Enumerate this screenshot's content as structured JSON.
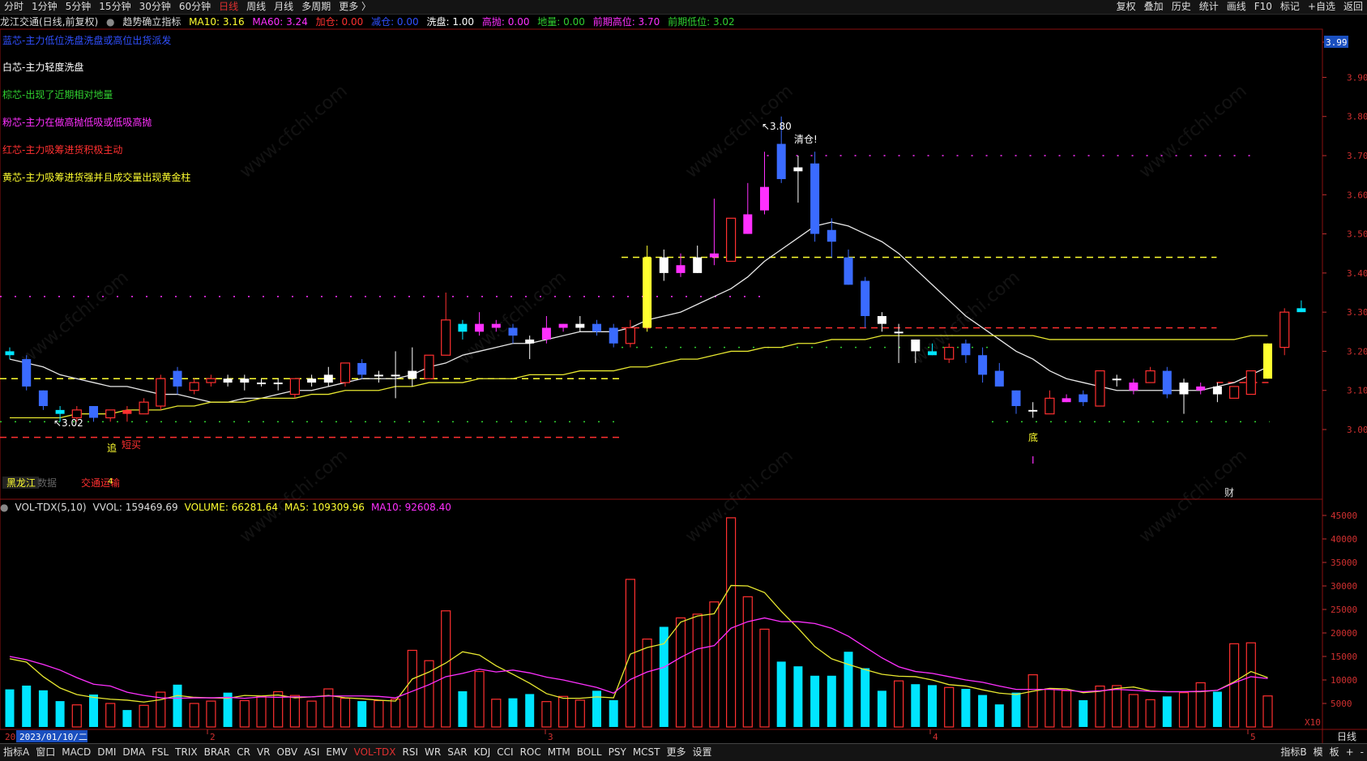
{
  "toolbar": {
    "periods": [
      "分时",
      "1分钟",
      "5分钟",
      "15分钟",
      "30分钟",
      "60分钟",
      "日线",
      "周线",
      "月线",
      "多周期",
      "更多 〉"
    ],
    "active_period": "日线",
    "right_items": [
      "复权",
      "叠加",
      "历史",
      "统计",
      "画线",
      "F10",
      "标记",
      "+自选",
      "返回"
    ]
  },
  "info": {
    "stock": "龙江交通(日线,前复权)",
    "indicator": "趋势确立指标",
    "ma10": "MA10: 3.16",
    "ma60": "MA60: 3.24",
    "jiacang": "加仓: 0.00",
    "jiancang": "减仓: 0.00",
    "xipan": "洗盘: 1.00",
    "gaopao": "高抛: 0.00",
    "diliang": "地量: 0.00",
    "qianqi_high": "前期高位: 3.70",
    "qianqi_low": "前期低位: 3.02"
  },
  "legend": [
    {
      "text": "蓝芯-主力低位洗盘洗盘或高位出货派发",
      "color": "#3050ff"
    },
    {
      "text": "白芯-主力轻度洗盘",
      "color": "#ffffff"
    },
    {
      "text": "棕芯-出现了近期相对地量",
      "color": "#30d030"
    },
    {
      "text": "粉芯-主力在做高抛低吸或低吸高抛",
      "color": "#ff30ff"
    },
    {
      "text": "红芯-主力吸筹进货积极主动",
      "color": "#ff3030"
    },
    {
      "text": "黄芯-主力吸筹进货强并且成交量出现黄金柱",
      "color": "#ffff30"
    }
  ],
  "annotations": {
    "high_label": "3.80",
    "low_label": "3.02",
    "qingcang": "清仓!",
    "zhui": "追",
    "duanmai": "短买",
    "di": "底",
    "i_mark": "I",
    "cai": "财",
    "heilongjiang": "黑龙江",
    "shuju": "数据",
    "jiaotong": "交通运输",
    "count": "4"
  },
  "price_axis": [
    "3.99",
    "3.90",
    "3.80",
    "3.70",
    "3.60",
    "3.50",
    "3.40",
    "3.30",
    "3.20",
    "3.10",
    "3.00"
  ],
  "volume_info": {
    "name": "VOL-TDX(5,10)",
    "vvol": "VVOL: 159469.69",
    "volume": "VOLUME: 66281.64",
    "ma5": "MA5: 109309.96",
    "ma10": "MA10: 92608.40"
  },
  "volume_axis": [
    "45000",
    "40000",
    "35000",
    "30000",
    "25000",
    "20000",
    "15000",
    "10000",
    "5000"
  ],
  "vol_unit": "X10",
  "date_axis": {
    "date_label": "2023/01/10/二",
    "months": [
      "2",
      "3",
      "4",
      "5"
    ],
    "start": "20"
  },
  "bottom_tabs": [
    "指标A",
    "窗口",
    "MACD",
    "DMI",
    "DMA",
    "FSL",
    "TRIX",
    "BRAR",
    "CR",
    "VR",
    "OBV",
    "ASI",
    "EMV",
    "VOL-TDX",
    "RSI",
    "WR",
    "SAR",
    "KDJ",
    "CCI",
    "ROC",
    "MTM",
    "BOLL",
    "PSY",
    "MCST",
    "更多",
    "设置"
  ],
  "active_tab": "VOL-TDX",
  "bottom_right": [
    "指标B",
    "模",
    "板",
    "+",
    "-"
  ],
  "period_label": "日线",
  "chart_data": {
    "type": "candlestick",
    "y_range": [
      2.98,
      4.0
    ],
    "vol_range": [
      0,
      45000
    ],
    "candles": [
      {
        "o": 3.2,
        "h": 3.21,
        "l": 3.18,
        "c": 3.19,
        "col": "cyan"
      },
      {
        "o": 3.18,
        "h": 3.19,
        "l": 3.1,
        "c": 3.11,
        "col": "blue"
      },
      {
        "o": 3.1,
        "h": 3.1,
        "l": 3.05,
        "c": 3.06,
        "col": "blue"
      },
      {
        "o": 3.05,
        "h": 3.06,
        "l": 3.02,
        "c": 3.04,
        "col": "cyan"
      },
      {
        "o": 3.03,
        "h": 3.06,
        "l": 3.02,
        "c": 3.05,
        "col": "red"
      },
      {
        "o": 3.06,
        "h": 3.06,
        "l": 3.02,
        "c": 3.03,
        "col": "blue"
      },
      {
        "o": 3.03,
        "h": 3.05,
        "l": 3.02,
        "c": 3.05,
        "col": "red"
      },
      {
        "o": 3.05,
        "h": 3.06,
        "l": 3.02,
        "c": 3.04,
        "col": "red"
      },
      {
        "o": 3.04,
        "h": 3.08,
        "l": 3.04,
        "c": 3.07,
        "col": "red"
      },
      {
        "o": 3.06,
        "h": 3.14,
        "l": 3.05,
        "c": 3.13,
        "col": "red"
      },
      {
        "o": 3.15,
        "h": 3.16,
        "l": 3.09,
        "c": 3.11,
        "col": "blue"
      },
      {
        "o": 3.1,
        "h": 3.13,
        "l": 3.09,
        "c": 3.12,
        "col": "red"
      },
      {
        "o": 3.12,
        "h": 3.14,
        "l": 3.11,
        "c": 3.13,
        "col": "red"
      },
      {
        "o": 3.13,
        "h": 3.14,
        "l": 3.11,
        "c": 3.12,
        "col": "white"
      },
      {
        "o": 3.12,
        "h": 3.14,
        "l": 3.1,
        "c": 3.13,
        "col": "white"
      },
      {
        "o": 3.12,
        "h": 3.13,
        "l": 3.11,
        "c": 3.12,
        "col": "white"
      },
      {
        "o": 3.12,
        "h": 3.13,
        "l": 3.1,
        "c": 3.12,
        "col": "white"
      },
      {
        "o": 3.09,
        "h": 3.13,
        "l": 3.08,
        "c": 3.13,
        "col": "red"
      },
      {
        "o": 3.12,
        "h": 3.14,
        "l": 3.11,
        "c": 3.13,
        "col": "white"
      },
      {
        "o": 3.12,
        "h": 3.16,
        "l": 3.11,
        "c": 3.14,
        "col": "white"
      },
      {
        "o": 3.12,
        "h": 3.17,
        "l": 3.11,
        "c": 3.17,
        "col": "red"
      },
      {
        "o": 3.17,
        "h": 3.18,
        "l": 3.13,
        "c": 3.14,
        "col": "blue"
      },
      {
        "o": 3.14,
        "h": 3.15,
        "l": 3.12,
        "c": 3.14,
        "col": "white"
      },
      {
        "o": 3.14,
        "h": 3.2,
        "l": 3.08,
        "c": 3.14,
        "col": "white"
      },
      {
        "o": 3.13,
        "h": 3.21,
        "l": 3.11,
        "c": 3.15,
        "col": "white"
      },
      {
        "o": 3.13,
        "h": 3.19,
        "l": 3.13,
        "c": 3.19,
        "col": "red"
      },
      {
        "o": 3.19,
        "h": 3.35,
        "l": 3.19,
        "c": 3.28,
        "col": "red"
      },
      {
        "o": 3.27,
        "h": 3.28,
        "l": 3.23,
        "c": 3.25,
        "col": "cyan"
      },
      {
        "o": 3.25,
        "h": 3.3,
        "l": 3.24,
        "c": 3.27,
        "col": "pink"
      },
      {
        "o": 3.26,
        "h": 3.28,
        "l": 3.25,
        "c": 3.27,
        "col": "pink"
      },
      {
        "o": 3.26,
        "h": 3.27,
        "l": 3.22,
        "c": 3.24,
        "col": "blue"
      },
      {
        "o": 3.23,
        "h": 3.24,
        "l": 3.18,
        "c": 3.22,
        "col": "white"
      },
      {
        "o": 3.23,
        "h": 3.29,
        "l": 3.22,
        "c": 3.26,
        "col": "pink"
      },
      {
        "o": 3.26,
        "h": 3.27,
        "l": 3.25,
        "c": 3.27,
        "col": "pink"
      },
      {
        "o": 3.26,
        "h": 3.29,
        "l": 3.25,
        "c": 3.27,
        "col": "white"
      },
      {
        "o": 3.27,
        "h": 3.28,
        "l": 3.24,
        "c": 3.25,
        "col": "blue"
      },
      {
        "o": 3.26,
        "h": 3.27,
        "l": 3.21,
        "c": 3.22,
        "col": "blue"
      },
      {
        "o": 3.22,
        "h": 3.28,
        "l": 3.21,
        "c": 3.26,
        "col": "red"
      },
      {
        "o": 3.26,
        "h": 3.47,
        "l": 3.25,
        "c": 3.44,
        "col": "yellow"
      },
      {
        "o": 3.44,
        "h": 3.46,
        "l": 3.38,
        "c": 3.4,
        "col": "white"
      },
      {
        "o": 3.4,
        "h": 3.45,
        "l": 3.39,
        "c": 3.42,
        "col": "pink"
      },
      {
        "o": 3.4,
        "h": 3.47,
        "l": 3.4,
        "c": 3.44,
        "col": "white"
      },
      {
        "o": 3.44,
        "h": 3.59,
        "l": 3.42,
        "c": 3.45,
        "col": "pink"
      },
      {
        "o": 3.43,
        "h": 3.54,
        "l": 3.43,
        "c": 3.54,
        "col": "red"
      },
      {
        "o": 3.5,
        "h": 3.63,
        "l": 3.5,
        "c": 3.55,
        "col": "pink"
      },
      {
        "o": 3.56,
        "h": 3.71,
        "l": 3.55,
        "c": 3.62,
        "col": "pink"
      },
      {
        "o": 3.73,
        "h": 3.8,
        "l": 3.63,
        "c": 3.64,
        "col": "blue"
      },
      {
        "o": 3.67,
        "h": 3.7,
        "l": 3.58,
        "c": 3.66,
        "col": "white"
      },
      {
        "o": 3.68,
        "h": 3.71,
        "l": 3.48,
        "c": 3.5,
        "col": "blue"
      },
      {
        "o": 3.51,
        "h": 3.54,
        "l": 3.44,
        "c": 3.48,
        "col": "blue"
      },
      {
        "o": 3.44,
        "h": 3.46,
        "l": 3.37,
        "c": 3.37,
        "col": "blue"
      },
      {
        "o": 3.38,
        "h": 3.39,
        "l": 3.26,
        "c": 3.29,
        "col": "blue"
      },
      {
        "o": 3.29,
        "h": 3.3,
        "l": 3.25,
        "c": 3.27,
        "col": "white"
      },
      {
        "o": 3.25,
        "h": 3.27,
        "l": 3.17,
        "c": 3.25,
        "col": "white"
      },
      {
        "o": 3.23,
        "h": 3.23,
        "l": 3.17,
        "c": 3.2,
        "col": "white"
      },
      {
        "o": 3.2,
        "h": 3.22,
        "l": 3.19,
        "c": 3.19,
        "col": "cyan"
      },
      {
        "o": 3.18,
        "h": 3.22,
        "l": 3.17,
        "c": 3.21,
        "col": "red"
      },
      {
        "o": 3.22,
        "h": 3.23,
        "l": 3.17,
        "c": 3.19,
        "col": "blue"
      },
      {
        "o": 3.19,
        "h": 3.21,
        "l": 3.12,
        "c": 3.14,
        "col": "blue"
      },
      {
        "o": 3.15,
        "h": 3.17,
        "l": 3.11,
        "c": 3.11,
        "col": "blue"
      },
      {
        "o": 3.1,
        "h": 3.1,
        "l": 3.04,
        "c": 3.06,
        "col": "blue"
      },
      {
        "o": 3.05,
        "h": 3.07,
        "l": 3.03,
        "c": 3.05,
        "col": "white"
      },
      {
        "o": 3.04,
        "h": 3.1,
        "l": 3.04,
        "c": 3.08,
        "col": "red"
      },
      {
        "o": 3.07,
        "h": 3.09,
        "l": 3.07,
        "c": 3.08,
        "col": "pink"
      },
      {
        "o": 3.09,
        "h": 3.1,
        "l": 3.06,
        "c": 3.07,
        "col": "blue"
      },
      {
        "o": 3.06,
        "h": 3.15,
        "l": 3.06,
        "c": 3.15,
        "col": "red"
      },
      {
        "o": 3.13,
        "h": 3.14,
        "l": 3.11,
        "c": 3.13,
        "col": "white"
      },
      {
        "o": 3.1,
        "h": 3.13,
        "l": 3.09,
        "c": 3.12,
        "col": "pink"
      },
      {
        "o": 3.12,
        "h": 3.16,
        "l": 3.12,
        "c": 3.15,
        "col": "red"
      },
      {
        "o": 3.15,
        "h": 3.16,
        "l": 3.08,
        "c": 3.09,
        "col": "blue"
      },
      {
        "o": 3.09,
        "h": 3.13,
        "l": 3.04,
        "c": 3.12,
        "col": "white"
      },
      {
        "o": 3.1,
        "h": 3.12,
        "l": 3.09,
        "c": 3.11,
        "col": "pink"
      },
      {
        "o": 3.11,
        "h": 3.12,
        "l": 3.07,
        "c": 3.09,
        "col": "white"
      },
      {
        "o": 3.08,
        "h": 3.11,
        "l": 3.08,
        "c": 3.11,
        "col": "red"
      },
      {
        "o": 3.09,
        "h": 3.15,
        "l": 3.09,
        "c": 3.15,
        "col": "red"
      },
      {
        "o": 3.13,
        "h": 3.22,
        "l": 3.13,
        "c": 3.22,
        "col": "yellow"
      },
      {
        "o": 3.21,
        "h": 3.31,
        "l": 3.19,
        "c": 3.3,
        "col": "red"
      },
      {
        "o": 3.3,
        "h": 3.33,
        "l": 3.3,
        "c": 3.31,
        "col": "cyan"
      }
    ],
    "volumes": [
      8000,
      8800,
      7800,
      5500,
      4700,
      6900,
      5000,
      3600,
      4600,
      7400,
      9000,
      5000,
      5500,
      7300,
      5600,
      6500,
      7500,
      6700,
      5500,
      8100,
      6100,
      5500,
      5600,
      5900,
      16300,
      14100,
      24700,
      7600,
      11800,
      5900,
      6100,
      7000,
      5400,
      6500,
      5700,
      7700,
      5700,
      31400,
      18700,
      21300,
      23200,
      24000,
      26600,
      44500,
      27700,
      20800,
      13900,
      12900,
      10900,
      10900,
      16000,
      12500,
      7700,
      9800,
      9100,
      8900,
      8400,
      8100,
      6800,
      4800,
      7300,
      11100,
      8100,
      7700,
      5700,
      8700,
      8800,
      6900,
      5800,
      6500,
      7300,
      9400,
      7500,
      17700,
      17900,
      6600
    ],
    "ma_vol_short": [
      14500,
      13800,
      10700,
      8300,
      6900,
      6300,
      5900,
      5700,
      5300,
      5800,
      6700,
      6300,
      6200,
      6100,
      6700,
      6600,
      6800,
      6200,
      6400,
      6700,
      6200,
      6000,
      5700,
      5500,
      10200,
      11700,
      13600,
      16000,
      15300,
      13000,
      11200,
      9300,
      7100,
      6100,
      6100,
      6400,
      6200,
      15500,
      16900,
      17700,
      22300,
      23600,
      24100,
      30100,
      30000,
      28600,
      24600,
      21000,
      17100,
      14500,
      13300,
      12200,
      11200,
      10800,
      10700,
      10000,
      9000,
      8700,
      7900,
      7200,
      6900,
      7600,
      8200,
      8100,
      7300,
      7600,
      8200,
      8500,
      7700,
      7500,
      7500,
      7500,
      7800,
      9600,
      11800,
      10500
    ],
    "ma_vol_long": [
      15000,
      14300,
      13300,
      12100,
      10500,
      9100,
      8700,
      7400,
      6700,
      6200,
      6100,
      6200,
      6200,
      6300,
      6100,
      6400,
      6300,
      6400,
      6400,
      6600,
      6600,
      6600,
      6500,
      6200,
      7600,
      9000,
      10700,
      11400,
      12300,
      11700,
      12100,
      11500,
      10600,
      10000,
      9200,
      8400,
      7200,
      10100,
      11700,
      12700,
      14800,
      16600,
      17300,
      21000,
      22400,
      23200,
      22400,
      22400,
      22000,
      21000,
      19300,
      17000,
      14700,
      12800,
      11800,
      11400,
      10700,
      10000,
      9500,
      8700,
      8000,
      8000,
      8000,
      7800,
      7500,
      7700,
      8000,
      7800,
      7600,
      7500,
      7500,
      7600,
      7800,
      9400,
      10700,
      10300
    ],
    "ma_price_short": [
      3.18,
      3.17,
      3.16,
      3.14,
      3.13,
      3.12,
      3.11,
      3.11,
      3.1,
      3.09,
      3.09,
      3.08,
      3.07,
      3.07,
      3.08,
      3.08,
      3.09,
      3.1,
      3.1,
      3.11,
      3.12,
      3.13,
      3.13,
      3.13,
      3.14,
      3.16,
      3.17,
      3.19,
      3.2,
      3.21,
      3.22,
      3.22,
      3.23,
      3.24,
      3.25,
      3.25,
      3.25,
      3.26,
      3.28,
      3.29,
      3.3,
      3.32,
      3.34,
      3.36,
      3.39,
      3.43,
      3.46,
      3.49,
      3.52,
      3.53,
      3.52,
      3.5,
      3.48,
      3.45,
      3.41,
      3.37,
      3.33,
      3.29,
      3.26,
      3.23,
      3.2,
      3.18,
      3.15,
      3.13,
      3.12,
      3.11,
      3.1,
      3.1,
      3.1,
      3.1,
      3.1,
      3.1,
      3.11,
      3.12,
      3.14,
      3.16
    ],
    "ma_price_long": [
      3.03,
      3.03,
      3.03,
      3.03,
      3.04,
      3.04,
      3.04,
      3.05,
      3.05,
      3.05,
      3.06,
      3.06,
      3.07,
      3.07,
      3.07,
      3.08,
      3.08,
      3.08,
      3.09,
      3.09,
      3.1,
      3.1,
      3.1,
      3.11,
      3.11,
      3.12,
      3.12,
      3.12,
      3.13,
      3.13,
      3.13,
      3.14,
      3.14,
      3.14,
      3.15,
      3.15,
      3.15,
      3.16,
      3.16,
      3.17,
      3.18,
      3.18,
      3.19,
      3.2,
      3.2,
      3.21,
      3.21,
      3.22,
      3.22,
      3.23,
      3.23,
      3.23,
      3.24,
      3.24,
      3.24,
      3.24,
      3.24,
      3.24,
      3.24,
      3.24,
      3.24,
      3.24,
      3.23,
      3.23,
      3.23,
      3.23,
      3.23,
      3.23,
      3.23,
      3.23,
      3.23,
      3.23,
      3.23,
      3.23,
      3.24,
      3.24
    ],
    "ref_levels": [
      {
        "y": 3.7,
        "color": "#ff30ff",
        "dash": "2,16",
        "from": 0.58,
        "to": 0.95
      },
      {
        "y": 3.44,
        "color": "#ffff30",
        "dash": "8,6",
        "from": 0.47,
        "to": 0.92
      },
      {
        "y": 3.34,
        "color": "#ff30ff",
        "dash": "2,16",
        "from": 0.0,
        "to": 0.58
      },
      {
        "y": 3.26,
        "color": "#ff3030",
        "dash": "8,6",
        "from": 0.47,
        "to": 0.92
      },
      {
        "y": 3.21,
        "color": "#30d030",
        "dash": "2,16",
        "from": 0.47,
        "to": 0.75
      },
      {
        "y": 3.13,
        "color": "#ffff30",
        "dash": "8,6",
        "from": 0.0,
        "to": 0.47
      },
      {
        "y": 3.12,
        "color": "#ff3030",
        "dash": "8,6",
        "from": 0.92,
        "to": 0.96
      },
      {
        "y": 3.02,
        "color": "#30d030",
        "dash": "2,16",
        "from": 0.0,
        "to": 0.47
      },
      {
        "y": 3.02,
        "color": "#30d030",
        "dash": "2,16",
        "from": 0.75,
        "to": 0.96
      },
      {
        "y": 2.98,
        "color": "#ff3030",
        "dash": "8,6",
        "from": 0.0,
        "to": 0.47
      }
    ]
  }
}
